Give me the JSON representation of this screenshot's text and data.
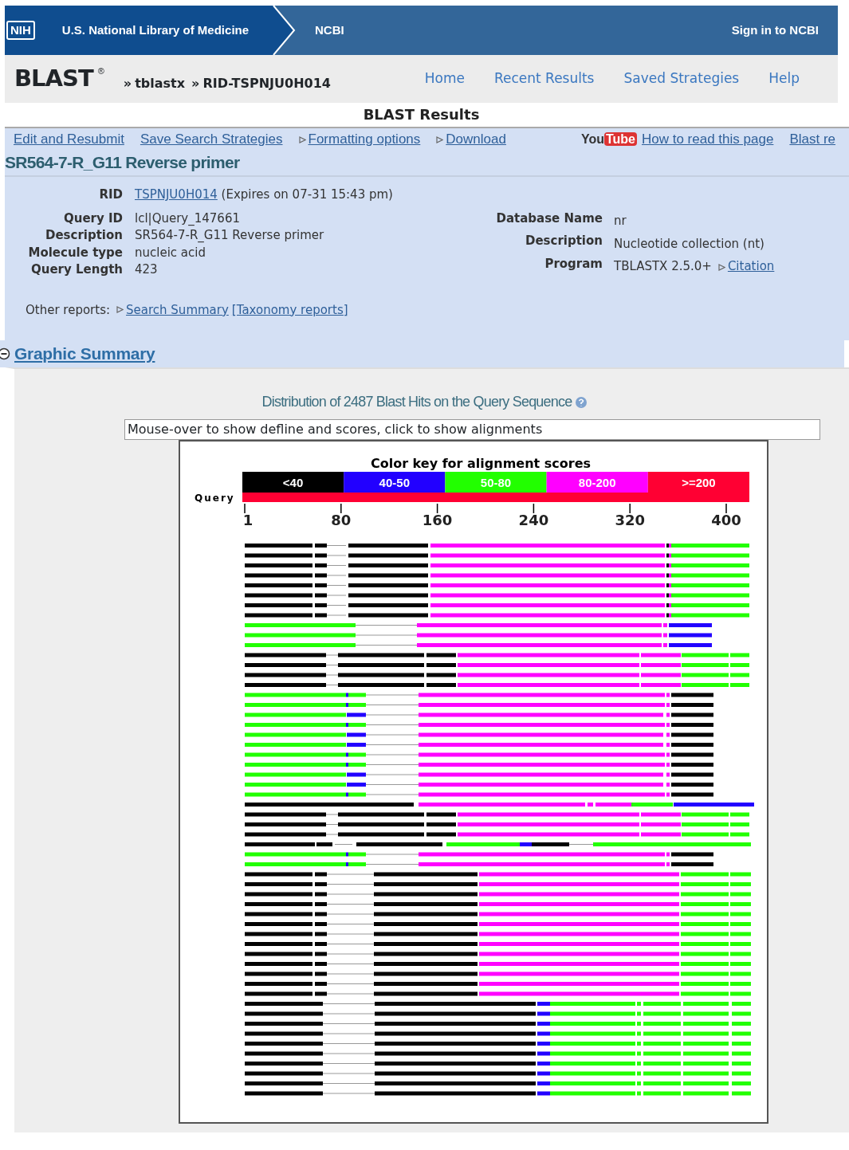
{
  "header": {
    "logo": "NIH",
    "org": "U.S. National Library of Medicine",
    "ncbi": "NCBI",
    "sign_in": "Sign in to NCBI"
  },
  "blast_bar": {
    "logo": "BLAST",
    "mark": "®",
    "crumbs": [
      {
        "sep": "»",
        "text": "tblastx"
      },
      {
        "sep": "»",
        "text": "RID-TSPNJU0H014"
      }
    ],
    "nav": [
      "Home",
      "Recent Results",
      "Saved Strategies",
      "Help"
    ]
  },
  "page_title": "BLAST Results",
  "toolbar": [
    {
      "kind": "plain",
      "text": "Edit and Resubmit"
    },
    {
      "kind": "plain",
      "text": "Save Search Strategies"
    },
    {
      "kind": "expander",
      "text": "Formatting options"
    },
    {
      "kind": "expander",
      "text": "Download"
    },
    {
      "kind": "video",
      "badge": [
        "You",
        "Tube"
      ],
      "text": "How to read this page"
    },
    {
      "kind": "plain",
      "text": "Blast re"
    }
  ],
  "query_title": "SR564-7-R_G11 Reverse primer",
  "rid": {
    "label": "RID",
    "link": "TSPNJU0H014",
    "note": "(Expires on 07-31 15:43 pm)"
  },
  "query_fields": [
    {
      "label": "Query ID",
      "value": "lcl|Query_147661"
    },
    {
      "label": "Description",
      "value": "SR564-7-R_G11 Reverse primer"
    },
    {
      "label": "Molecule type",
      "value": "nucleic acid"
    },
    {
      "label": "Query Length",
      "value": "423"
    }
  ],
  "database_fields": [
    {
      "label": "Database Name",
      "value": "nr"
    },
    {
      "label": "Description",
      "value": "Nucleotide collection (nt)"
    },
    {
      "label": "Program",
      "value": "TBLASTX 2.5.0+",
      "link": "Citation"
    }
  ],
  "other_reports": {
    "label": "Other reports:",
    "links": [
      "Search Summary",
      "[Taxonomy reports]"
    ]
  },
  "graphic_summary": {
    "title": "Graphic Summary",
    "expanded": true,
    "distribution_title": "Distribution of 2487 Blast Hits on the Query Sequence",
    "hover_text": "Mouse-over to show defline and scores, click to show alignments",
    "color_key": {
      "title": "Color key for alignment scores",
      "ranges": [
        {
          "label": "<40",
          "color": "#000000"
        },
        {
          "label": "40-50",
          "color": "#2200ff"
        },
        {
          "label": "50-80",
          "color": "#22ff00"
        },
        {
          "label": "80-200",
          "color": "#ff00ff"
        },
        {
          "label": ">=200",
          "color": "#ff0033"
        }
      ]
    },
    "query_label": "Query",
    "ticks": [
      "1",
      "80",
      "160",
      "240",
      "320",
      "400"
    ]
  }
}
